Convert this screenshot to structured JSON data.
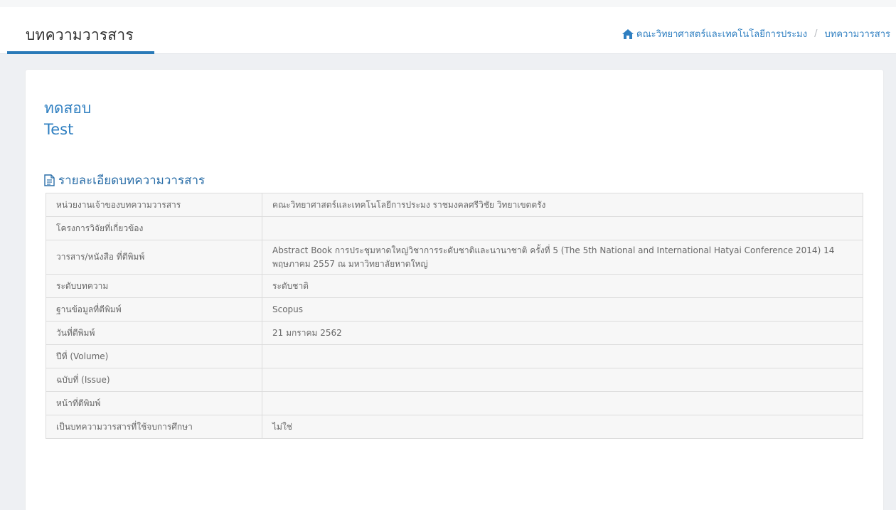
{
  "header": {
    "page_title": "บทความวารสาร",
    "breadcrumb": {
      "home_icon": "home-icon",
      "home_label": "คณะวิทยาศาสตร์และเทคโนโลยีการประมง",
      "separator": "/",
      "current": "บทความวารสาร"
    },
    "accent_color": "#2f7fc1"
  },
  "article": {
    "title_th": "ทดสอบ",
    "title_en": "Test",
    "section_icon": "document-icon",
    "section_heading": "รายละเอียดบทความวารสาร",
    "rows": [
      {
        "label": "หน่วยงานเจ้าของบทความวารสาร",
        "value": "คณะวิทยาศาสตร์และเทคโนโลยีการประมง ราชมงคลศรีวิชัย วิทยาเขตตรัง"
      },
      {
        "label": "โครงการวิจัยที่เกี่ยวข้อง",
        "value": ""
      },
      {
        "label": "วารสาร/หนังสือ ที่ตีพิมพ์",
        "value": "Abstract Book การประชุมหาดใหญ่วิชาการระดับชาติและนานาชาติ ครั้งที่ 5 (The 5th National and International Hatyai Conference 2014) 14 พฤษภาคม 2557 ณ มหาวิทยาลัยหาดใหญ่"
      },
      {
        "label": "ระดับบทความ",
        "value": "ระดับชาติ"
      },
      {
        "label": "ฐานข้อมูลที่ตีพิมพ์",
        "value": "Scopus"
      },
      {
        "label": "วันที่ตีพิมพ์",
        "value": "21 มกราคม 2562"
      },
      {
        "label": "ปีที่ (Volume)",
        "value": ""
      },
      {
        "label": "ฉบับที่ (Issue)",
        "value": ""
      },
      {
        "label": "หน้าที่ตีพิมพ์",
        "value": ""
      },
      {
        "label": "เป็นบทความวารสารที่ใช้จบการศึกษา",
        "value": "ไม่ใช่"
      }
    ]
  }
}
